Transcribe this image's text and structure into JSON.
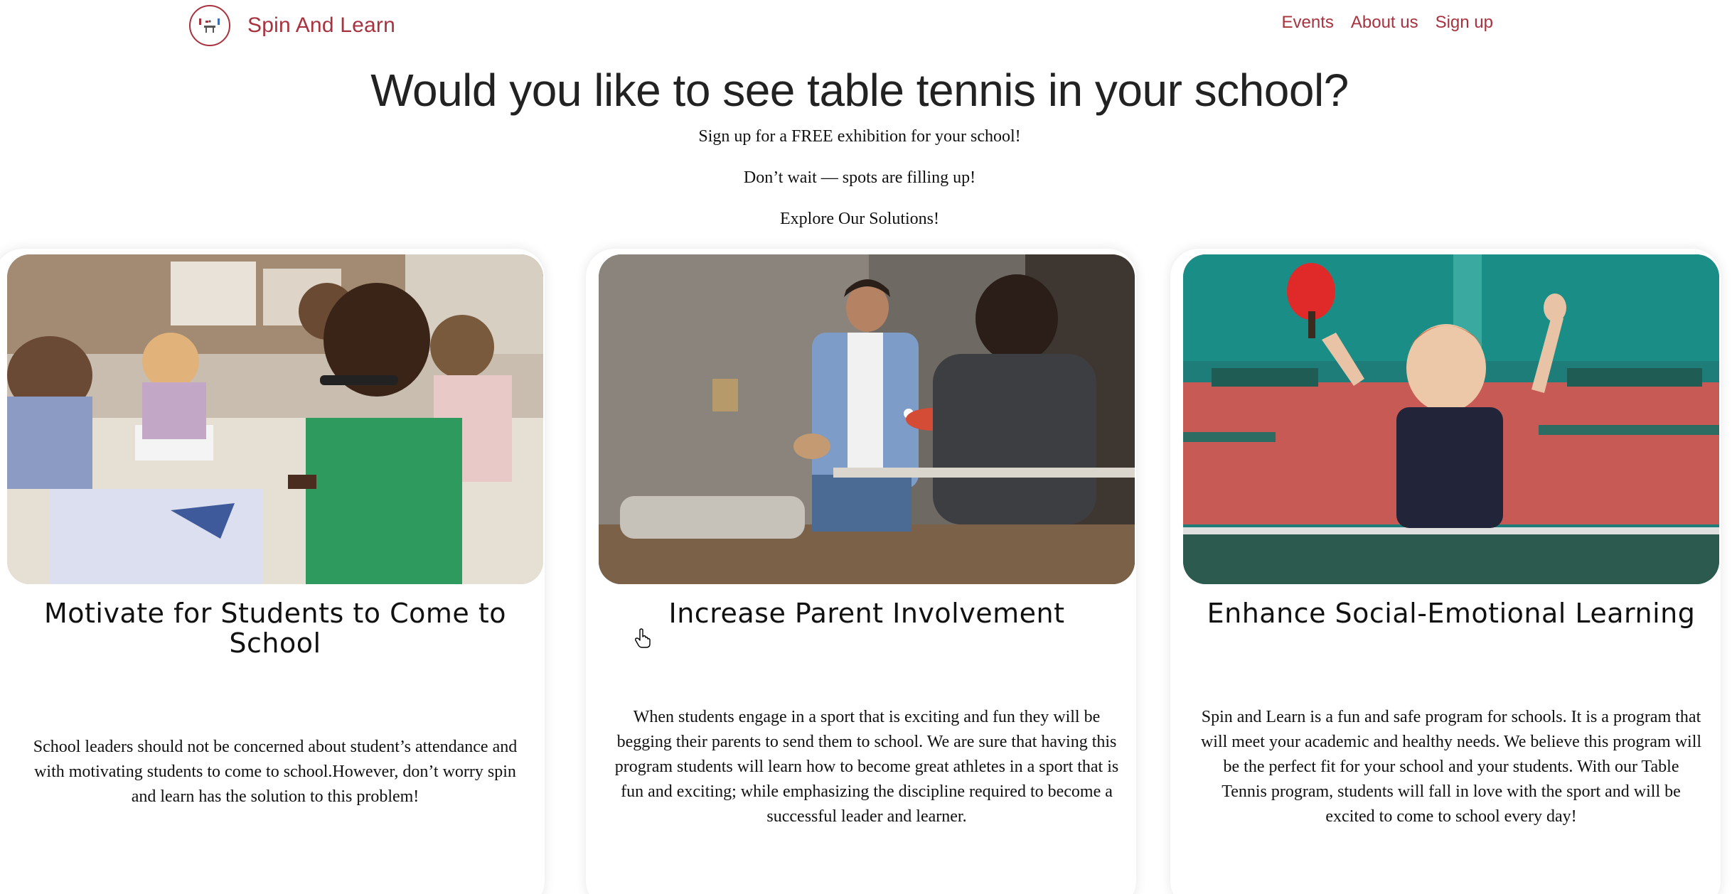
{
  "navbar": {
    "brand_name": "Spin And Learn",
    "links": [
      "Events",
      "About us",
      "Sign up"
    ],
    "accent_color": "#a8333f"
  },
  "hero": {
    "title": "Would you like to see table tennis in your school?",
    "line1": "Sign up for a FREE exhibition for your school!",
    "line2": "Don’t wait — spots are filling up!",
    "line3": "Explore Our Solutions!"
  },
  "cards": [
    {
      "image": "classroom-students-drawing-photo",
      "title": "Motivate for Students to Come to School",
      "text": "School leaders should not be concerned about student’s attendance and with motivating students to come to school.However, don’t worry spin and learn has the solution to this problem!"
    },
    {
      "image": "father-and-son-playing-ping-pong-photo",
      "title": "Increase Parent Involvement",
      "text": "When students engage in a sport that is exciting and fun they will be begging their parents to send them to school. We are sure that having this program students will learn how to become great athletes in a sport that is fun and exciting; while emphasizing the discipline required to become a successful leader and learner."
    },
    {
      "image": "boy-cheering-with-red-paddle-photo",
      "title": "Enhance Social-Emotional Learning",
      "text": "Spin and Learn is a fun and safe program for schools. It is a program that will meet your academic and healthy needs. We believe this program will be the perfect fit for your school and your students. With our Table Tennis program, students will fall in love with the sport and will be excited to come to school every day!"
    }
  ]
}
